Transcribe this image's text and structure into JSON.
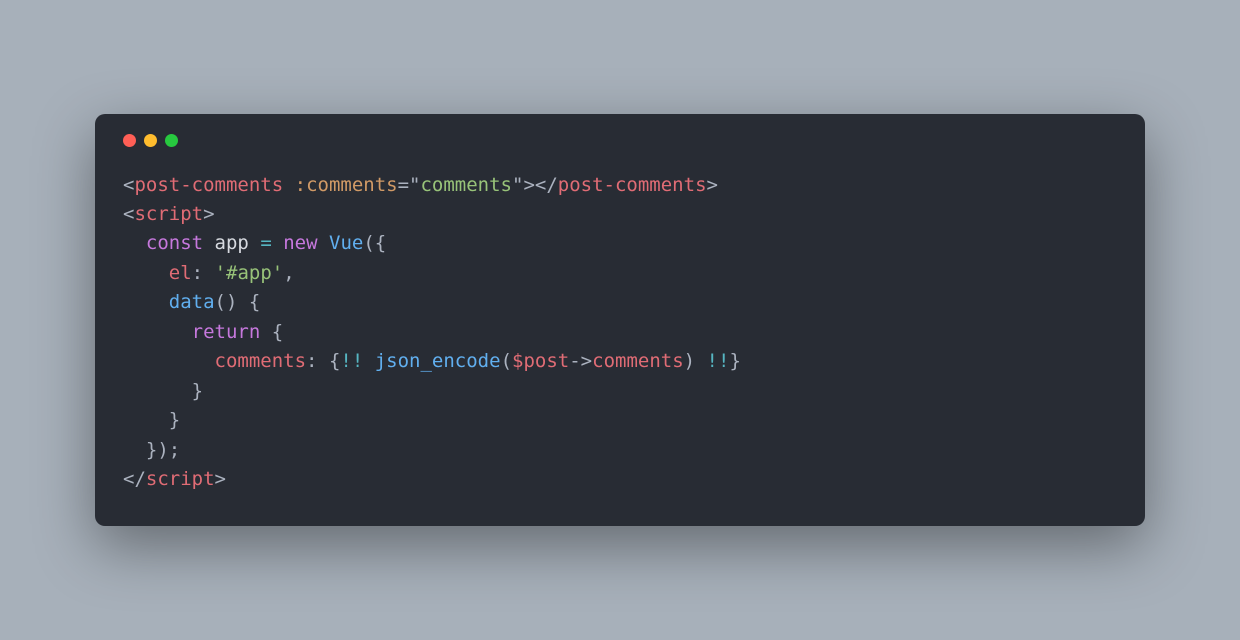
{
  "window": {
    "dots": [
      "red",
      "yellow",
      "green"
    ]
  },
  "code": {
    "line1": {
      "open_bracket": "<",
      "tag1": "post-comments",
      "space1": " ",
      "attr": ":comments",
      "eq": "=",
      "quote1": "\"",
      "val": "comments",
      "quote2": "\"",
      "close1": ">",
      "open2": "</",
      "tag2": "post-comments",
      "close2": ">"
    },
    "line2": {
      "open": "<",
      "tag": "script",
      "close": ">"
    },
    "line3": {
      "indent": "  ",
      "kw_const": "const",
      "sp1": " ",
      "var_app": "app",
      "sp2": " ",
      "eq": "=",
      "sp3": " ",
      "kw_new": "new",
      "sp4": " ",
      "fn_vue": "Vue",
      "paren_open": "({"
    },
    "line4": {
      "indent": "    ",
      "prop": "el",
      "colon": ":",
      "sp": " ",
      "str": "'#app'",
      "comma": ","
    },
    "line5": {
      "indent": "    ",
      "fn": "data",
      "parens": "()",
      "sp": " ",
      "brace": "{"
    },
    "line6": {
      "indent": "      ",
      "kw": "return",
      "sp": " ",
      "brace": "{"
    },
    "line7": {
      "indent": "        ",
      "prop": "comments",
      "colon": ":",
      "sp1": " ",
      "open": "{",
      "bang1": "!!",
      "sp2": " ",
      "fn": "json_encode",
      "paren_open": "(",
      "var": "$post",
      "arrow": "->",
      "member": "comments",
      "paren_close": ")",
      "sp3": " ",
      "bang2": "!!",
      "close": "}"
    },
    "line8": {
      "indent": "      ",
      "brace": "}"
    },
    "line9": {
      "indent": "    ",
      "brace": "}"
    },
    "line10": {
      "indent": "  ",
      "close": "});"
    },
    "line11": {
      "open": "</",
      "tag": "script",
      "close": ">"
    }
  }
}
